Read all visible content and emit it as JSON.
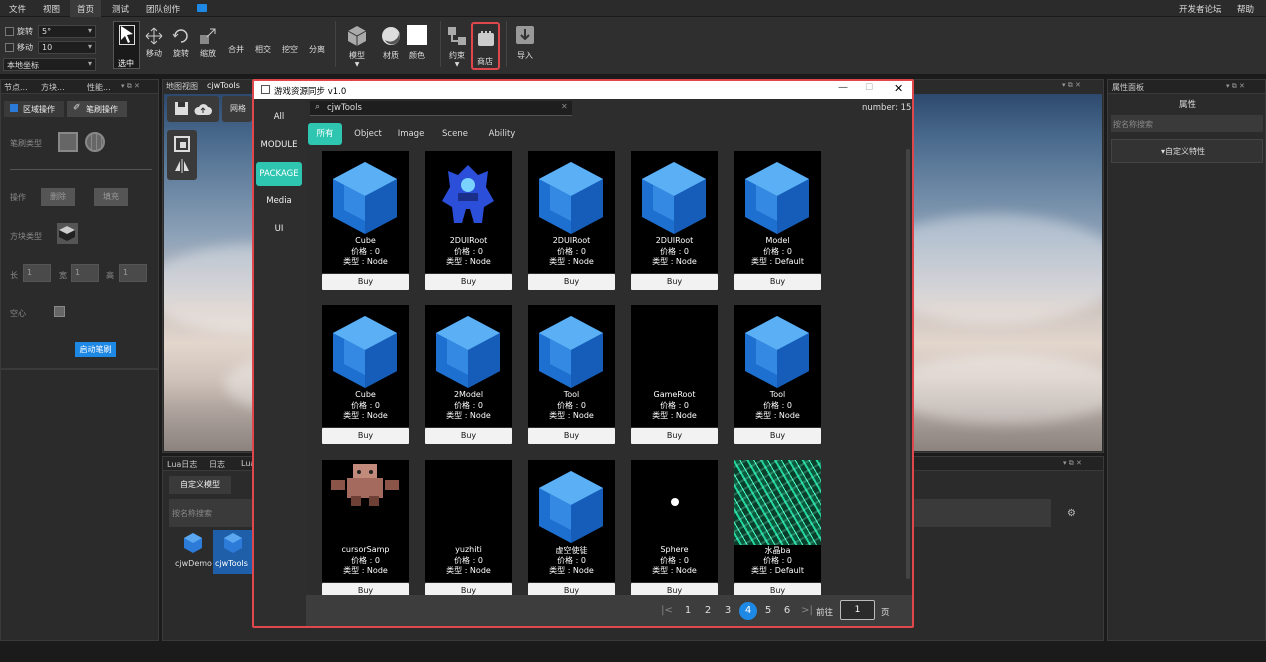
{
  "menubar": {
    "items": [
      "文件",
      "视图",
      "首页",
      "测试",
      "团队创作"
    ],
    "right": [
      "开发者论坛",
      "帮助"
    ],
    "active_index": 2
  },
  "toolbar": {
    "rotate_label": "旋转",
    "rotate_value": "5°",
    "move_label": "移动",
    "move_value": "10",
    "coord_value": "本地坐标",
    "tools": [
      "选中",
      "移动",
      "旋转",
      "缩放"
    ],
    "ops": [
      "合并",
      "相交",
      "挖空",
      "分离"
    ],
    "assets": [
      "模型",
      "材质",
      "颜色"
    ],
    "constraint": "约束",
    "store": "商店",
    "import": "导入"
  },
  "left_panel": {
    "tabs": [
      "节点...",
      "方块...",
      "性能..."
    ],
    "sub_tabs": [
      "区域操作",
      "笔刷操作"
    ],
    "brush_type_label": "笔刷类型",
    "op_label": "操作",
    "delete_label": "删除",
    "fill_label": "填充",
    "block_type_label": "方块类型",
    "len_label": "长",
    "wid_label": "宽",
    "hei_label": "高",
    "len_value": "1",
    "wid_value": "1",
    "hei_value": "1",
    "hollow_label": "空心",
    "start_button": "启动笔刷"
  },
  "viewport": {
    "tabs": [
      "地图视图",
      "cjwTools"
    ],
    "grid_button": "网格"
  },
  "bottom_panel": {
    "tabs": [
      "Lua日志",
      "日志",
      "Lua"
    ],
    "custom_model_tab": "自定义模型",
    "search_placeholder": "按名称搜索",
    "items": [
      "cjwDemo",
      "cjwTools"
    ]
  },
  "right_panel": {
    "title": "属性面板",
    "header": "属性",
    "search_placeholder": "按名称搜索",
    "custom_attr": "▾自定义特性"
  },
  "dialog": {
    "title": "游戏资源同步 v1.0",
    "search_value": "cjwTools",
    "number_label": "number: 15",
    "side_items": [
      "All",
      "MODULE",
      "PACKAGE",
      "Media",
      "UI"
    ],
    "side_active": 2,
    "categories": [
      "所有",
      "Object",
      "Image",
      "Scene",
      "Ability"
    ],
    "buy_label": "Buy",
    "cards": [
      {
        "name": "Cube",
        "price": "价格 : 0",
        "type": "类型 : Node",
        "img": "cube-icon"
      },
      {
        "name": "2DUIRoot",
        "price": "价格 : 0",
        "type": "类型 : Node",
        "img": "robot-icon"
      },
      {
        "name": "2DUIRoot",
        "price": "价格 : 0",
        "type": "类型 : Node",
        "img": "cube-icon"
      },
      {
        "name": "2DUIRoot",
        "price": "价格 : 0",
        "type": "类型 : Node",
        "img": "cube-icon"
      },
      {
        "name": "Model",
        "price": "价格 : 0",
        "type": "类型 : Default",
        "img": "cube-icon"
      },
      {
        "name": "Cube",
        "price": "价格 : 0",
        "type": "类型 : Node",
        "img": "cube-icon"
      },
      {
        "name": "2Model",
        "price": "价格 : 0",
        "type": "类型 : Node",
        "img": "cube-icon"
      },
      {
        "name": "Tool",
        "price": "价格 : 0",
        "type": "类型 : Node",
        "img": "cube-icon"
      },
      {
        "name": "GameRoot",
        "price": "价格 : 0",
        "type": "类型 : Node",
        "img": "blank"
      },
      {
        "name": "Tool",
        "price": "价格 : 0",
        "type": "类型 : Node",
        "img": "cube-icon"
      },
      {
        "name": "cursorSamp",
        "price": "价格 : 0",
        "type": "类型 : Node",
        "img": "character-icon"
      },
      {
        "name": "yuzhiti",
        "price": "价格 : 0",
        "type": "类型 : Node",
        "img": "blank"
      },
      {
        "name": "虚空使徒",
        "price": "价格 : 0",
        "type": "类型 : Node",
        "img": "cube-icon"
      },
      {
        "name": "Sphere",
        "price": "价格 : 0",
        "type": "类型 : Node",
        "img": "dot-icon"
      },
      {
        "name": "水晶ba",
        "price": "价格 : 0",
        "type": "类型 : Default",
        "img": "crystal-icon"
      }
    ],
    "pager": {
      "pages": [
        "1",
        "2",
        "3",
        "4",
        "5",
        "6"
      ],
      "active_page": "4",
      "goto_label": "前往",
      "goto_value": "1",
      "page_suffix": "页"
    }
  },
  "colors": {
    "accent": "#2ec6b0",
    "page_active": "#1e88e5",
    "highlight": "#e0474c"
  }
}
